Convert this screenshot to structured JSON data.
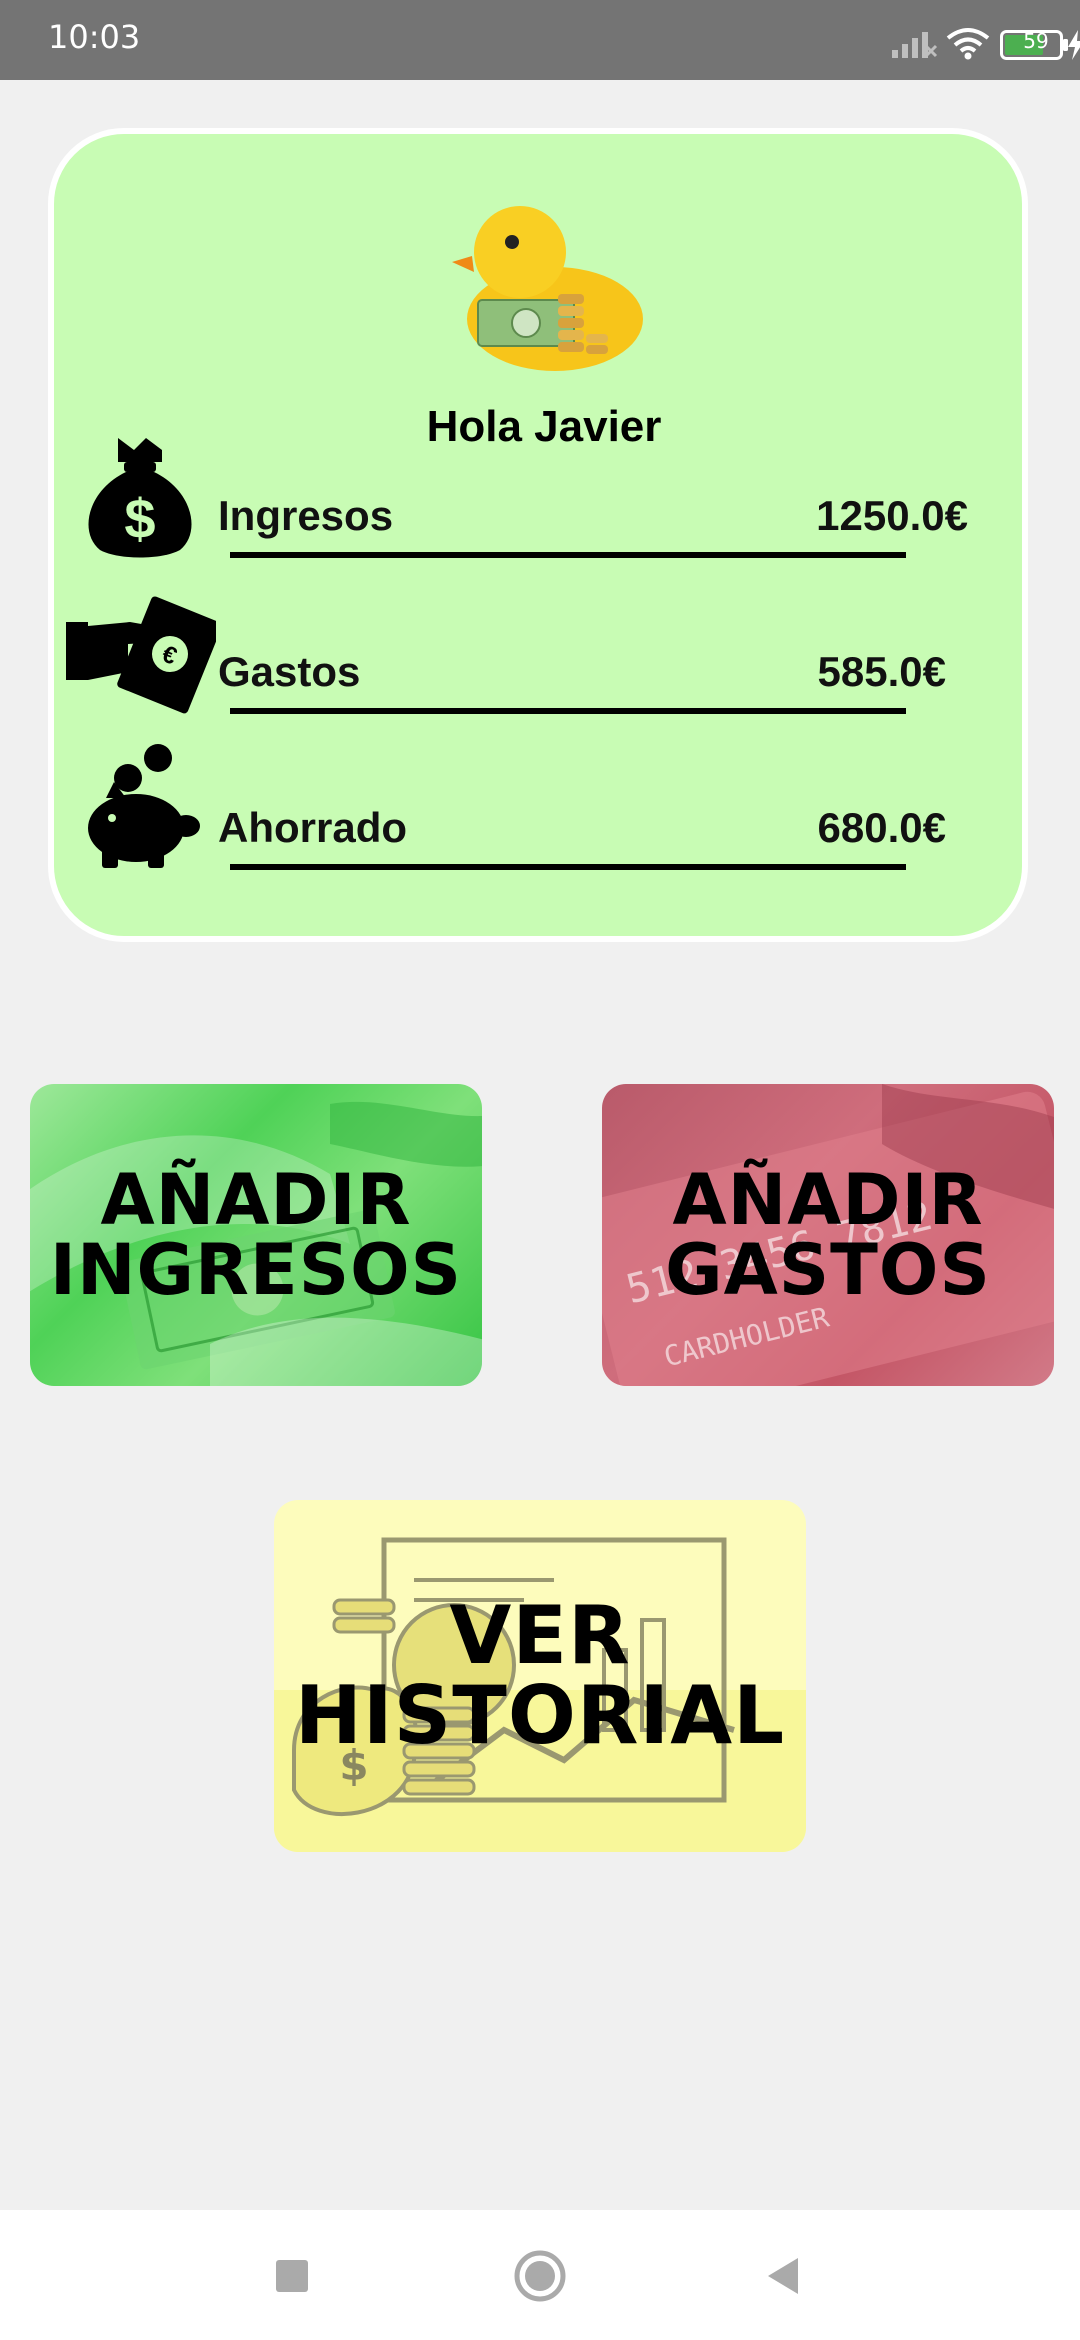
{
  "status_bar": {
    "time": "10:03",
    "battery": "59",
    "icons": [
      "signal-icon",
      "wifi-icon",
      "battery-icon",
      "charging-bolt-icon"
    ]
  },
  "summary_card": {
    "greeting": "Hola Javier",
    "background_color": "#c8fcb4",
    "rows": [
      {
        "icon": "money-bag-icon",
        "label": "Ingresos",
        "value": "1250.0€"
      },
      {
        "icon": "hand-cash-icon",
        "label": "Gastos",
        "value": "585.0€"
      },
      {
        "icon": "piggy-bank-icon",
        "label": "Ahorrado",
        "value": "680.0€"
      }
    ]
  },
  "actions": {
    "add_income": {
      "line1": "AÑADIR",
      "line2": "INGRESOS",
      "color": "#4fd257"
    },
    "add_expense": {
      "line1": "AÑADIR",
      "line2": "GASTOS",
      "color": "#c45666"
    },
    "view_history": {
      "line1": "VER",
      "line2": "HISTORIAL",
      "color": "#fdfcbc"
    }
  },
  "nav_bar": {
    "buttons": [
      "recents-square-icon",
      "home-circle-icon",
      "back-triangle-icon"
    ]
  }
}
